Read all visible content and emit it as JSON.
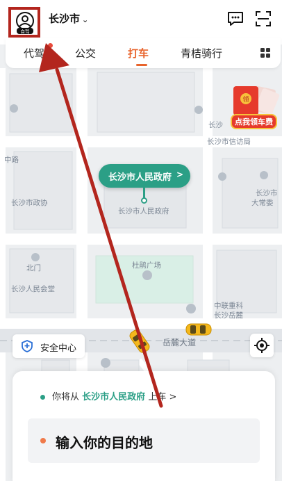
{
  "header": {
    "avatar_badge": "自驾",
    "city": "长沙市",
    "message_icon": "message-bubble-icon",
    "scan_icon": "scan-icon"
  },
  "tabs": [
    {
      "label": "代驾",
      "has_dot": true
    },
    {
      "label": "公交"
    },
    {
      "label": "打车",
      "active": true
    },
    {
      "label": "青桔骑行"
    }
  ],
  "map": {
    "labels": {
      "changsha1": "长沙",
      "changsha_xinfang": "长沙市信访局",
      "zhonglu": "中路",
      "changsha_daxue": "长沙市",
      "daxue2": "大常委",
      "changsha_zhengxie": "长沙市政协",
      "peoples_gov_map": "长沙市人民政府",
      "beimen": "北门",
      "dujuan_square": "杜鹃广场",
      "peoples_hall": "长沙人民会堂",
      "zhonglian": "中联重科",
      "yuelu_label": "长沙岳麓",
      "yuelu_avenue": "岳麓大道"
    }
  },
  "promo": {
    "label": "点我领车费",
    "coin_text": "领"
  },
  "poi": {
    "name": "长沙市人民政府",
    "chevron": ">"
  },
  "safety": {
    "label": "安全中心"
  },
  "sheet": {
    "pickup_prefix": "你将从",
    "pickup_place": "长沙市人民政府",
    "pickup_suffix": "上车",
    "pickup_chevron": ">",
    "destination_placeholder": "输入你的目的地"
  },
  "colors": {
    "accent": "#e8642c",
    "brand_green": "#2b9f86",
    "annotation_red": "#b3261e"
  }
}
